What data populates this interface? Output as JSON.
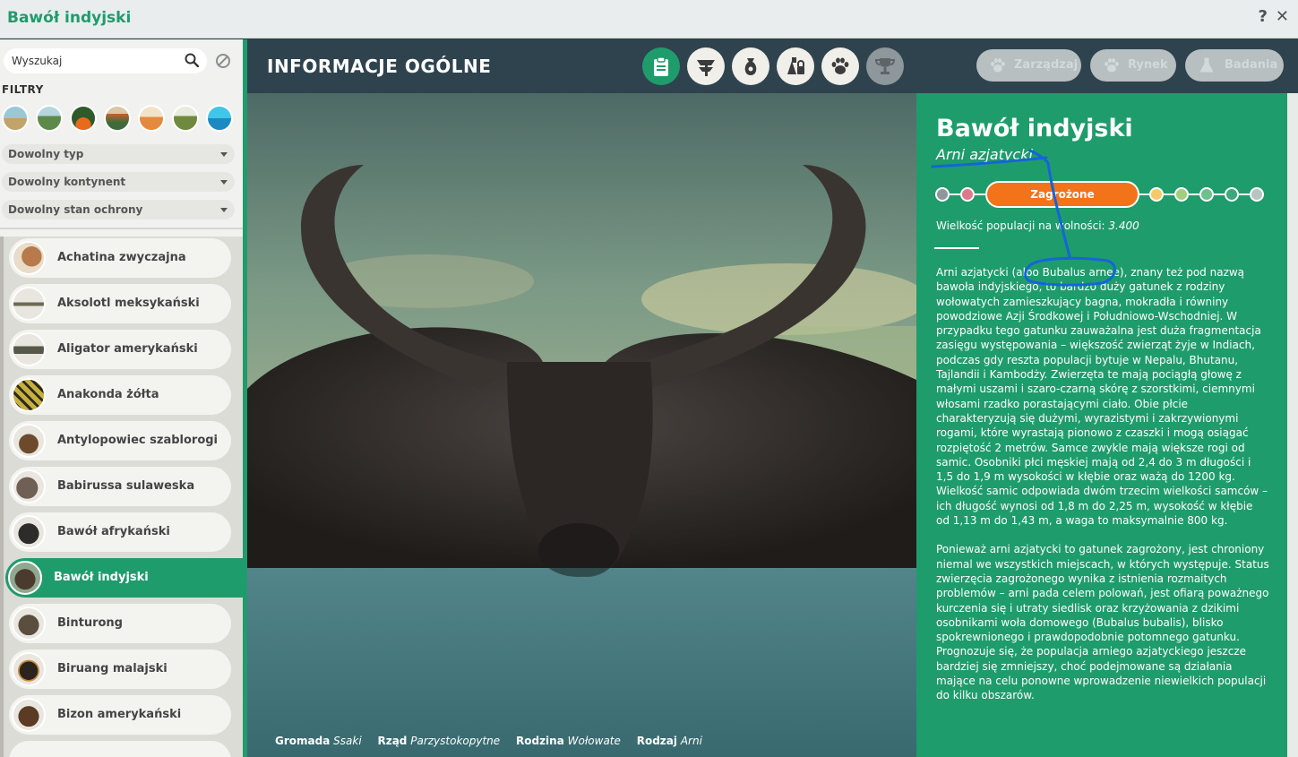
{
  "window": {
    "title": "Bawół indyjski",
    "help": "?",
    "close": "✕"
  },
  "sidebar": {
    "search_placeholder": "Wyszukaj",
    "filters_label": "FILTRY",
    "biomes": [
      "grassland",
      "temperate",
      "tropical",
      "taiga",
      "desert",
      "tundra",
      "aquatic"
    ],
    "dropdowns": [
      "Dowolny typ",
      "Dowolny kontynent",
      "Dowolny stan ochrony"
    ],
    "species": [
      "Achatina zwyczajna",
      "Aksolotl meksykański",
      "Aligator amerykański",
      "Anakonda żółta",
      "Antylopowiec szablorogi",
      "Babirussa sulaweska",
      "Bawół afrykański",
      "Bawół indyjski",
      "Binturong",
      "Biruang malajski",
      "Bizon amerykański"
    ],
    "selected_index": 7
  },
  "header": {
    "title": "INFORMACJE OGÓLNE",
    "tabs": [
      "info-clipboard",
      "habitat",
      "food-sack",
      "enrichment",
      "paw",
      "trophy"
    ],
    "buttons": [
      "Zarządzaj",
      "Rynek",
      "Badania"
    ]
  },
  "taxonomy": [
    {
      "label": "Gromada",
      "value": "Ssaki"
    },
    {
      "label": "Rząd",
      "value": "Parzystokopytne"
    },
    {
      "label": "Rodzina",
      "value": "Wołowate"
    },
    {
      "label": "Rodzaj",
      "value": "Arni"
    }
  ],
  "info": {
    "name": "Bawół indyjski",
    "latin": "Arni azjatycki",
    "status": "Zagrożone",
    "population_label": "Wielkość populacji na wolności:",
    "population_value": "3.400",
    "description_1": "Arni azjatycki (albo Bubalus arnee), znany też pod nazwą bawoła indyjskiego, to bardzo duży gatunek z rodziny wołowatych zamieszkujący bagna, mokradła i równiny powodziowe Azji Środkowej i Południowo-Wschodniej. W przypadku tego gatunku zauważalna jest duża fragmentacja zasięgu występowania – większość zwierząt żyje w Indiach, podczas gdy reszta populacji bytuje w Nepalu, Bhutanu, Tajlandii i Kambodży. Zwierzęta te mają pociągłą głowę z małymi uszami i szaro-czarną skórę z szorstkimi, ciemnymi włosami rzadko porastającymi ciało. Obie płcie charakteryzują się dużymi, wyrazistymi i zakrzywionymi rogami, które wyrastają pionowo z czaszki i mogą osiągać rozpiętość 2 metrów. Samce zwykle mają większe rogi od samic. Osobniki płci męskiej mają od 2,4 do 3 m długości i 1,5 do 1,9 m wysokości w kłębie oraz ważą do 1200 kg. Wielkość samic odpowiada dwóm trzecim wielkości samców – ich długość wynosi od 1,8 m do 2,25 m, wysokość w kłębie od 1,13 m do 1,43 m, a waga to maksymalnie 800 kg.",
    "description_2": "Ponieważ arni azjatycki to gatunek zagrożony, jest chroniony niemal we wszystkich miejscach, w których występuje. Status zwierzęcia zagrożonego wynika z istnienia rozmaitych problemów – arni pada celem polowań, jest ofiarą poważnego kurczenia się i utraty siedlisk oraz krzyżowania z dzikimi osobnikami woła domowego (Bubalus bubalis), blisko spokrewnionego i prawdopodobnie potomnego gatunku. Prognozuje się, że populacja arniego azjatyckiego jeszcze bardziej się zmniejszy, choć podejmowane są działania mające na celu ponowne wprowadzenie niewielkich populacji do kilku obszarów."
  },
  "colors": {
    "accent": "#1f9c6c",
    "header": "#2f434e",
    "status": "#f2731a"
  }
}
